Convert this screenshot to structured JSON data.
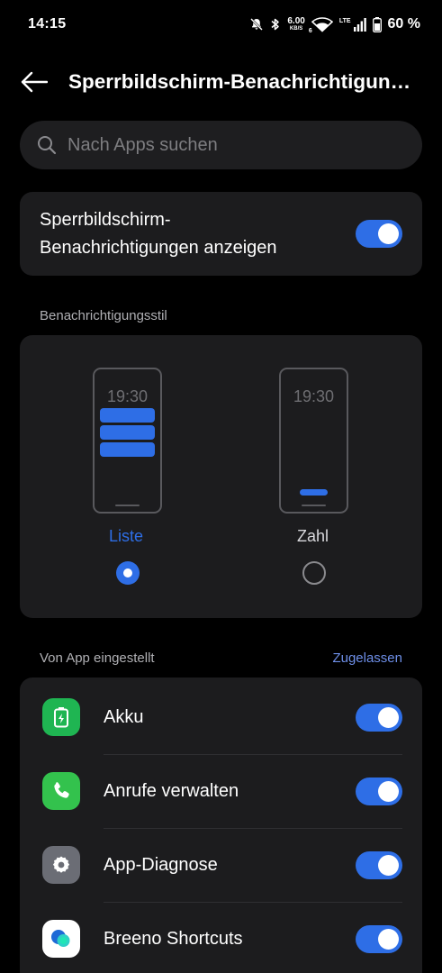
{
  "status_bar": {
    "time": "14:15",
    "net_speed_value": "6.00",
    "net_speed_unit": "KB/S",
    "wifi_badge": "6",
    "cell_type": "LTE",
    "battery_percent": "60 %",
    "icons": [
      "mute-icon",
      "bluetooth-icon",
      "wifi-icon",
      "cellular-signal-icon",
      "battery-icon"
    ]
  },
  "header": {
    "title": "Sperrbildschirm-Benachrichtigungen",
    "back_icon": "back-arrow-icon"
  },
  "search": {
    "placeholder": "Nach Apps suchen",
    "value": ""
  },
  "main_toggle": {
    "label_line1": "Sperrbildschirm-",
    "label_line2": "Benachrichtigungen anzeigen",
    "enabled": true
  },
  "notification_style": {
    "section_label": "Benachrichtigungsstil",
    "preview_clock": "19:30",
    "options": [
      {
        "label": "Liste",
        "selected": true
      },
      {
        "label": "Zahl",
        "selected": false
      }
    ]
  },
  "apps_section": {
    "label": "Von App eingestellt",
    "action_label": "Zugelassen",
    "apps": [
      {
        "name": "Akku",
        "icon": "battery-app-icon",
        "enabled": true
      },
      {
        "name": "Anrufe verwalten",
        "icon": "phone-app-icon",
        "enabled": true
      },
      {
        "name": "App-Diagnose",
        "icon": "settings-gear-app-icon",
        "enabled": true
      },
      {
        "name": "Breeno Shortcuts",
        "icon": "breeno-app-icon",
        "enabled": true
      }
    ]
  },
  "colors": {
    "background": "#000000",
    "card": "#1c1c1e",
    "accent": "#2e6ee6",
    "link": "#6e8fe8",
    "muted_text": "#b0b0b4"
  }
}
